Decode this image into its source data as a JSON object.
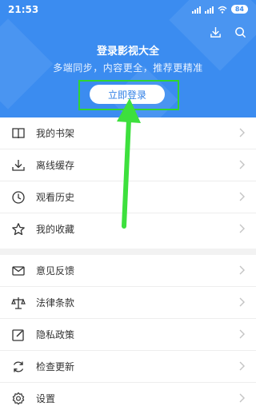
{
  "status_bar": {
    "time": "21:53",
    "battery": "84"
  },
  "header": {
    "title": "登录影视大全",
    "subtitle": "多端同步，内容更全，推荐更精准",
    "login_button": "立即登录",
    "icons": [
      "download-icon",
      "search-icon"
    ]
  },
  "menu_group_1": {
    "items": [
      {
        "label": "我的书架",
        "icon": "book-icon"
      },
      {
        "label": "离线缓存",
        "icon": "download-icon"
      },
      {
        "label": "观看历史",
        "icon": "clock-icon"
      },
      {
        "label": "我的收藏",
        "icon": "star-icon"
      }
    ]
  },
  "menu_group_2": {
    "items": [
      {
        "label": "意见反馈",
        "icon": "mail-icon"
      },
      {
        "label": "法律条款",
        "icon": "scale-icon"
      },
      {
        "label": "隐私政策",
        "icon": "edit-icon"
      },
      {
        "label": "检查更新",
        "icon": "refresh-icon"
      },
      {
        "label": "设置",
        "icon": "gear-icon"
      }
    ]
  },
  "colors": {
    "header_bg": "#3b8cf0",
    "highlight": "#2fd52f",
    "arrow": "#3de03d"
  }
}
